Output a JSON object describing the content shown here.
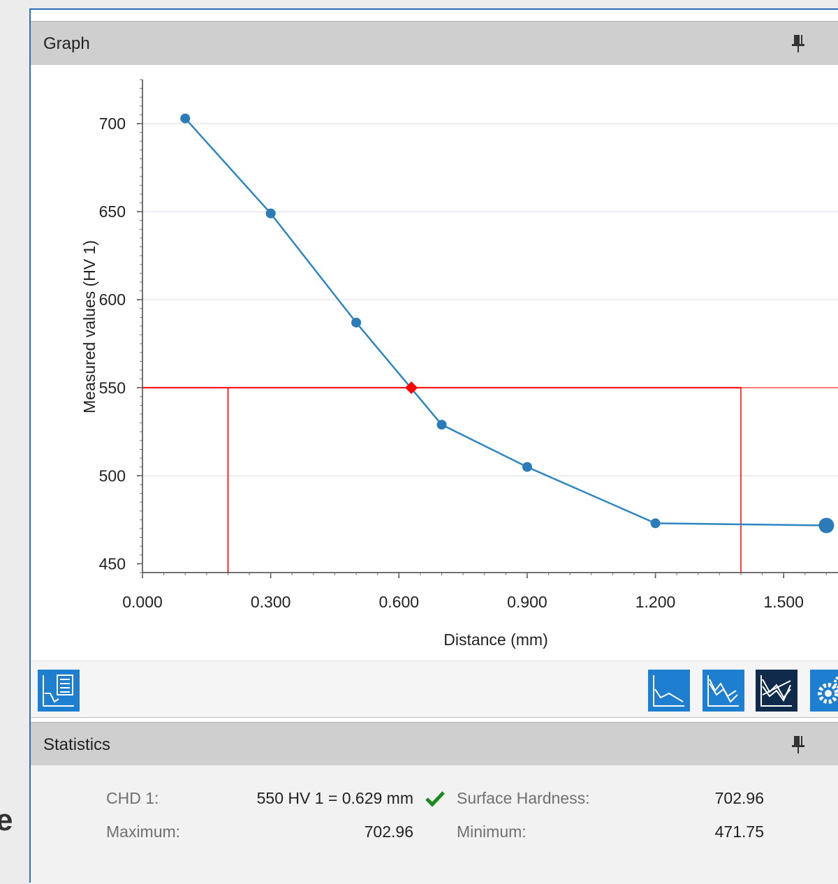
{
  "background_fragment": "e",
  "graph_panel": {
    "title": "Graph"
  },
  "chart_data": {
    "type": "line",
    "xlabel": "Distance (mm)",
    "ylabel": "Measured values (HV 1)",
    "xlim": [
      0.0,
      1.65
    ],
    "ylim": [
      445,
      725
    ],
    "x_ticks": [
      0.0,
      0.3,
      0.6,
      0.9,
      1.2,
      1.5
    ],
    "x_tick_labels": [
      "0.000",
      "0.300",
      "0.600",
      "0.900",
      "1.200",
      "1.500"
    ],
    "y_ticks": [
      450,
      500,
      550,
      600,
      650,
      700
    ],
    "y_tick_labels": [
      "450",
      "500",
      "550",
      "600",
      "650",
      "700"
    ],
    "grid": "horizontal",
    "series": [
      {
        "color": "#2e86c1",
        "points": [
          {
            "x": 0.1,
            "y": 702.96
          },
          {
            "x": 0.3,
            "y": 649
          },
          {
            "x": 0.5,
            "y": 587
          },
          {
            "x": 0.7,
            "y": 529
          },
          {
            "x": 0.9,
            "y": 505
          },
          {
            "x": 1.2,
            "y": 473
          },
          {
            "x": 1.6,
            "y": 471.75
          }
        ]
      }
    ],
    "threshold": {
      "y": 550,
      "color": "#ff0000"
    },
    "intersection": {
      "x": 0.629,
      "y": 550,
      "color": "#ff0000"
    },
    "limit_lines": [
      0.2,
      1.4
    ]
  },
  "toolbar": {
    "left_button_icon": "chart-legend-icon",
    "right_buttons": [
      "line-chart-icon",
      "envelope-chart-icon",
      "multi-series-chart-icon",
      "settings-gears-icon"
    ],
    "accent": "#1e7fd1",
    "active_color": "#0f2a4a"
  },
  "statistics_panel": {
    "title": "Statistics",
    "chd_label": "CHD 1:",
    "chd_value": "550 HV 1 = 0.629 mm",
    "surface_label": "Surface Hardness:",
    "surface_value": "702.96",
    "max_label": "Maximum:",
    "max_value": "702.96",
    "min_label": "Minimum:",
    "min_value": "471.75",
    "ok_color": "#1a8a1a"
  }
}
